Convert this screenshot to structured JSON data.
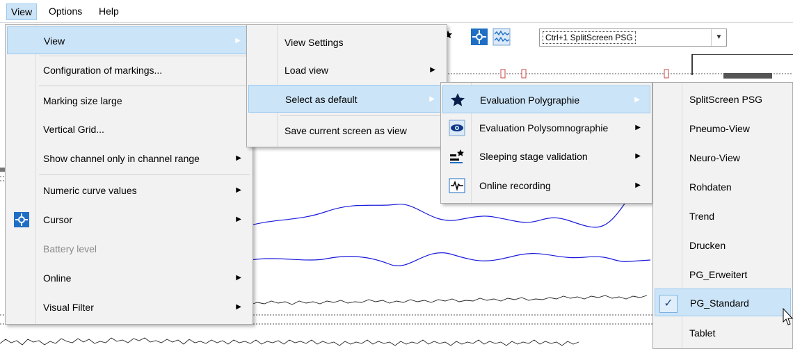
{
  "menubar": {
    "items": [
      "View",
      "Options",
      "Help"
    ]
  },
  "toolbar": {
    "view_combo_value": "Ctrl+1 SplitScreen PSG",
    "icons": [
      "sleep-stage-icon",
      "cursor-icon",
      "signal-wave-icon"
    ]
  },
  "menu_view": {
    "items": [
      {
        "label": "View",
        "submenu": true,
        "highlighted": true
      },
      {
        "label": "Configuration of markings..."
      },
      {
        "label": "Marking size large"
      },
      {
        "label": "Vertical Grid..."
      },
      {
        "label": "Show channel only in channel range",
        "submenu": true
      },
      {
        "label": "Numeric curve values",
        "submenu": true
      },
      {
        "label": "Cursor",
        "submenu": true,
        "icon": "cursor-icon"
      },
      {
        "label": "Battery level",
        "disabled": true
      },
      {
        "label": "Online",
        "submenu": true
      },
      {
        "label": "Visual Filter",
        "submenu": true
      }
    ]
  },
  "menu_view_sub": {
    "items": [
      {
        "label": "View Settings"
      },
      {
        "label": "Load view",
        "submenu": true
      },
      {
        "label": "Select as default",
        "submenu": true,
        "highlighted": true
      },
      {
        "label": "Save current screen as view"
      }
    ]
  },
  "menu_default": {
    "items": [
      {
        "label": "Evaluation Polygraphie",
        "submenu": true,
        "highlighted": true,
        "icon": "star-icon"
      },
      {
        "label": "Evaluation Polysomnographie",
        "submenu": true,
        "icon": "eye-icon"
      },
      {
        "label": "Sleeping stage validation",
        "submenu": true,
        "icon": "sleep-stage-icon"
      },
      {
        "label": "Online recording",
        "submenu": true,
        "icon": "online-recording-icon"
      }
    ]
  },
  "menu_layouts": {
    "items": [
      {
        "label": "SplitScreen PSG"
      },
      {
        "label": "Pneumo-View"
      },
      {
        "label": "Neuro-View"
      },
      {
        "label": "Rohdaten"
      },
      {
        "label": "Trend"
      },
      {
        "label": "Drucken"
      },
      {
        "label": "PG_Erweitert"
      },
      {
        "label": "PG_Standard",
        "checked": true,
        "highlighted": true
      },
      {
        "label": "Tablet"
      }
    ]
  },
  "colors": {
    "highlight": "#cce4f7",
    "highlight_border": "#99c9ef",
    "signal_blue": "#1a1adc",
    "menu_bg": "#f2f2f2",
    "icon_blue": "#1e6fc4"
  }
}
